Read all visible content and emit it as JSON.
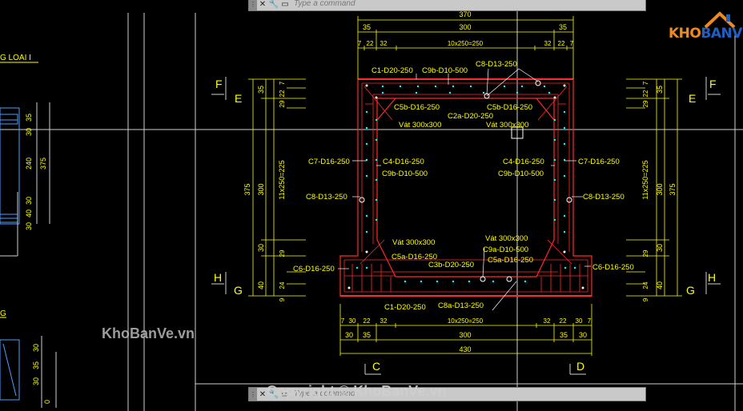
{
  "command_bar_top": {
    "placeholder": "Type a command"
  },
  "command_bar_bottom": {
    "placeholder": "Type a command"
  },
  "watermark": {
    "site_left": "KhoBanVe.vn",
    "copyright": "Copyright © KhoBanVe.vn"
  },
  "logo": {
    "brand": "KHOBANVE"
  },
  "left_panel": {
    "title1": "G LOAI I",
    "title2": "G",
    "dims_vertical": [
      "35",
      "30",
      "240",
      "375",
      "30",
      "40",
      "30"
    ],
    "dims_bottom": [
      "30",
      "35",
      "30",
      "0"
    ]
  },
  "section_marks": {
    "F_left": "F",
    "E_left": "E",
    "H_left": "H",
    "G_left": "G",
    "F_right": "F",
    "E_right": "E",
    "H_right": "H",
    "G_right": "G",
    "C": "C",
    "D": "D"
  },
  "dims_top": {
    "overall": "370",
    "d35_l": "35",
    "d300": "300",
    "d35_r": "35",
    "d7_l": "7",
    "d22_l": "22",
    "d32_l": "32",
    "spacing": "10x250=250",
    "d32_r": "32",
    "d22_r": "22",
    "d7_r": "7"
  },
  "dims_bottom": {
    "d7_l": "7",
    "d30_l": "30",
    "d22_l": "22",
    "d32_l": "32",
    "spacing": "10x250=250",
    "d32_r": "32",
    "d22_r": "22",
    "d30_r": "30",
    "d7_r": "7",
    "r30_l": "30",
    "r35_l": "35",
    "r300": "300",
    "r35_r": "35",
    "r30_r": "30",
    "overall": "430"
  },
  "dims_left": {
    "d7": "7",
    "d22": "22",
    "d29a": "29",
    "d35": "35",
    "d375": "375",
    "d300": "300",
    "spacing": "11x250=225",
    "d29b": "29",
    "d30": "30",
    "d24": "24",
    "d40": "40",
    "d9": "9"
  },
  "dims_right": {
    "d7": "7",
    "d22": "22",
    "d29a": "29",
    "d35": "35",
    "d375": "375",
    "d300": "300",
    "spacing": "11x250=225",
    "d29b": "29",
    "d30": "30",
    "d24": "24",
    "d40": "40",
    "d9": "9"
  },
  "rebar_labels": {
    "c1_top": "C1-D20-250",
    "c9b_top": "C9b-D10-500",
    "c8_top": "C8-D13-250",
    "c5b_left": "C5b-D16-250",
    "c5b_right": "C5b-D16-250",
    "c2a": "C2a-D20-250",
    "vat_tl": "Vát 300x300",
    "vat_tr": "Vát 300x300",
    "c7_left": "C7-D16-250",
    "c4_left": "C4-D16-250",
    "c9b_left": "C9b-D10-500",
    "c4_right": "C4-D16-250",
    "c9b_right": "C9b-D10-500",
    "c7_right": "C7-D16-250",
    "c8_left": "C8-D13-250",
    "c8_right": "C8-D13-250",
    "vat_bl": "Vát 300x300",
    "vat_br": "Vát 300x300",
    "c5a_left": "C5a-D16-250",
    "c9a": "C9a-D10-500",
    "c5a_right": "C5a-D16-250",
    "c3b": "C3b-D20-250",
    "c6_left": "C6-D16-250",
    "c6_right": "C6-D16-250",
    "c1_bottom": "C1-D20-250",
    "c8a": "C8a-D13-250"
  },
  "colors": {
    "background": "#000000",
    "dim": "#ffff00",
    "concrete": "#ff2a2a",
    "rebar": "#ffffff",
    "stirrup": "#00ffff",
    "frame": "#cfcfcf",
    "logo_orange": "#f08a1c",
    "logo_blue": "#1f5fbf"
  }
}
